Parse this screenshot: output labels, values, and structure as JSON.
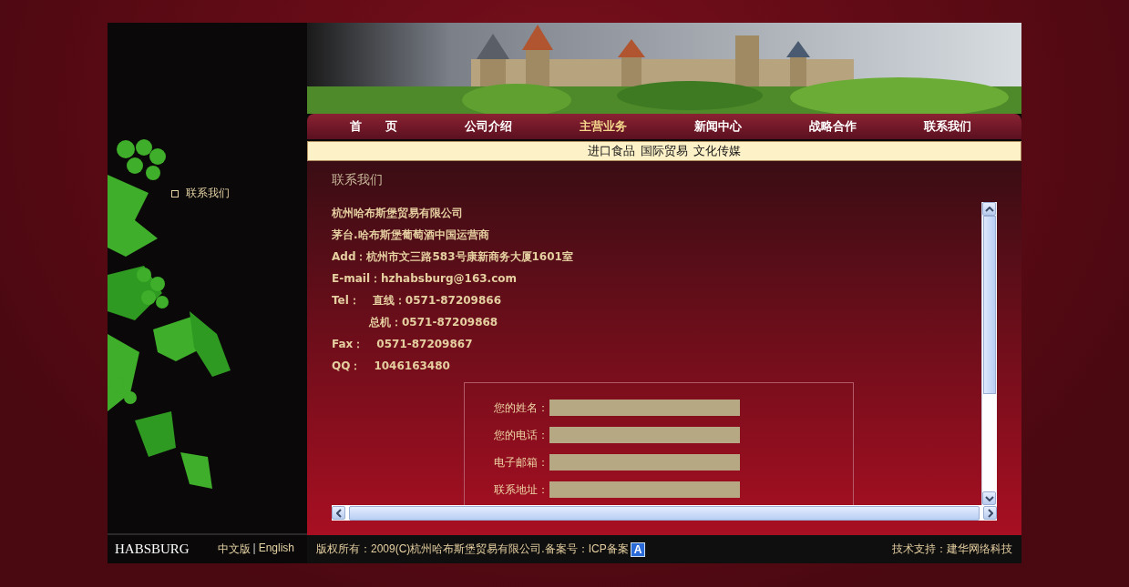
{
  "sidebar": {
    "items": [
      {
        "label": "联系我们"
      }
    ]
  },
  "footer_left": {
    "logo": "HABSBURG",
    "lang_cn": "中文版",
    "separator": "|",
    "lang_en": "English"
  },
  "nav": [
    {
      "label": "首　　页",
      "selected": false
    },
    {
      "label": "公司介绍",
      "selected": false
    },
    {
      "label": "主营业务",
      "selected": true
    },
    {
      "label": "新闻中心",
      "selected": false
    },
    {
      "label": "战略合作",
      "selected": false
    },
    {
      "label": "联系我们",
      "selected": false
    }
  ],
  "subnav": [
    "进口食品",
    "国际贸易",
    "文化传媒"
  ],
  "content": {
    "title": "联系我们",
    "lines": [
      {
        "kind": "text",
        "value": "杭州哈布斯堡贸易有限公司"
      },
      {
        "kind": "text",
        "value": "茅台.哈布斯堡葡萄酒中国运营商"
      },
      {
        "kind": "field",
        "label": "Add：",
        "value": "杭州市文三路583号康新商务大厦1601室"
      },
      {
        "kind": "field",
        "label": "E-mail：",
        "value": "hzhabsburg@163.com"
      },
      {
        "kind": "wide",
        "label": "Tel：",
        "value": "直线：0571-87209866"
      },
      {
        "kind": "continuation",
        "value": "总机：0571-87209868"
      },
      {
        "kind": "wide",
        "label": "Fax：",
        "value": "0571-87209867"
      },
      {
        "kind": "wide",
        "label": "QQ：",
        "value": "1046163480"
      }
    ],
    "form": [
      {
        "label": "您的姓名："
      },
      {
        "label": "您的电话："
      },
      {
        "label": "电子邮箱："
      },
      {
        "label": "联系地址："
      }
    ]
  },
  "footer": {
    "copyright": "版权所有：2009(C)杭州哈布斯堡贸易有限公司.备案号：ICP备案",
    "badge": "A",
    "support": "技术支持：建华网络科技"
  }
}
